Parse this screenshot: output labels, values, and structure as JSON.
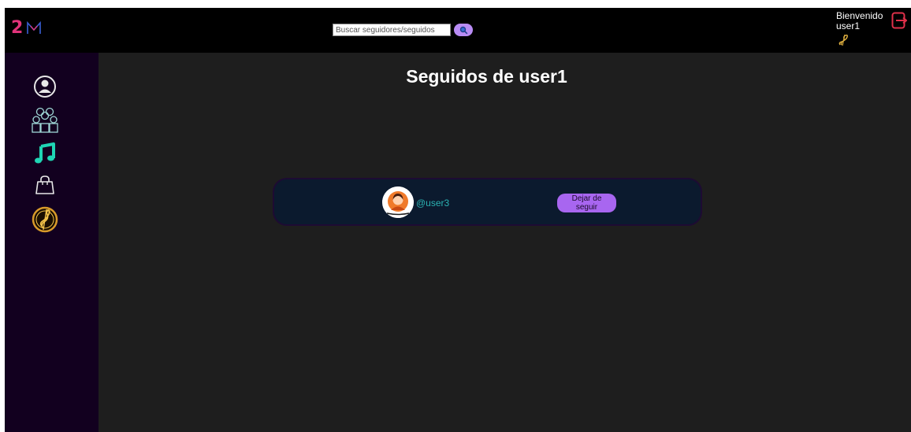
{
  "header": {
    "logo_text": "2",
    "search": {
      "placeholder": "Buscar seguidores/seguidos",
      "value": ""
    },
    "search_button_icon": "search-icon",
    "welcome_label": "Bienvenido",
    "username": "user1",
    "welcome_icon": "treble-clef-icon",
    "logout_icon": "logout-icon"
  },
  "sidebar": {
    "items": [
      {
        "icon": "profile-icon"
      },
      {
        "icon": "group-icon"
      },
      {
        "icon": "music-note-icon"
      },
      {
        "icon": "shopping-bag-icon"
      },
      {
        "icon": "treble-clef-medal-icon"
      }
    ]
  },
  "main": {
    "title": "Seguidos de user1",
    "following": [
      {
        "handle": "@user3",
        "button_label": "Dejar de seguir",
        "avatar_icon": "user-avatar-icon"
      }
    ]
  },
  "colors": {
    "background": "#1e1e1e",
    "topbar": "#000000",
    "sidebar": "#12001f",
    "card": "#0b1a2e",
    "accent_purple": "#a866f0",
    "accent_teal": "#2bb3b3",
    "logo_pink": "#e0337a"
  }
}
